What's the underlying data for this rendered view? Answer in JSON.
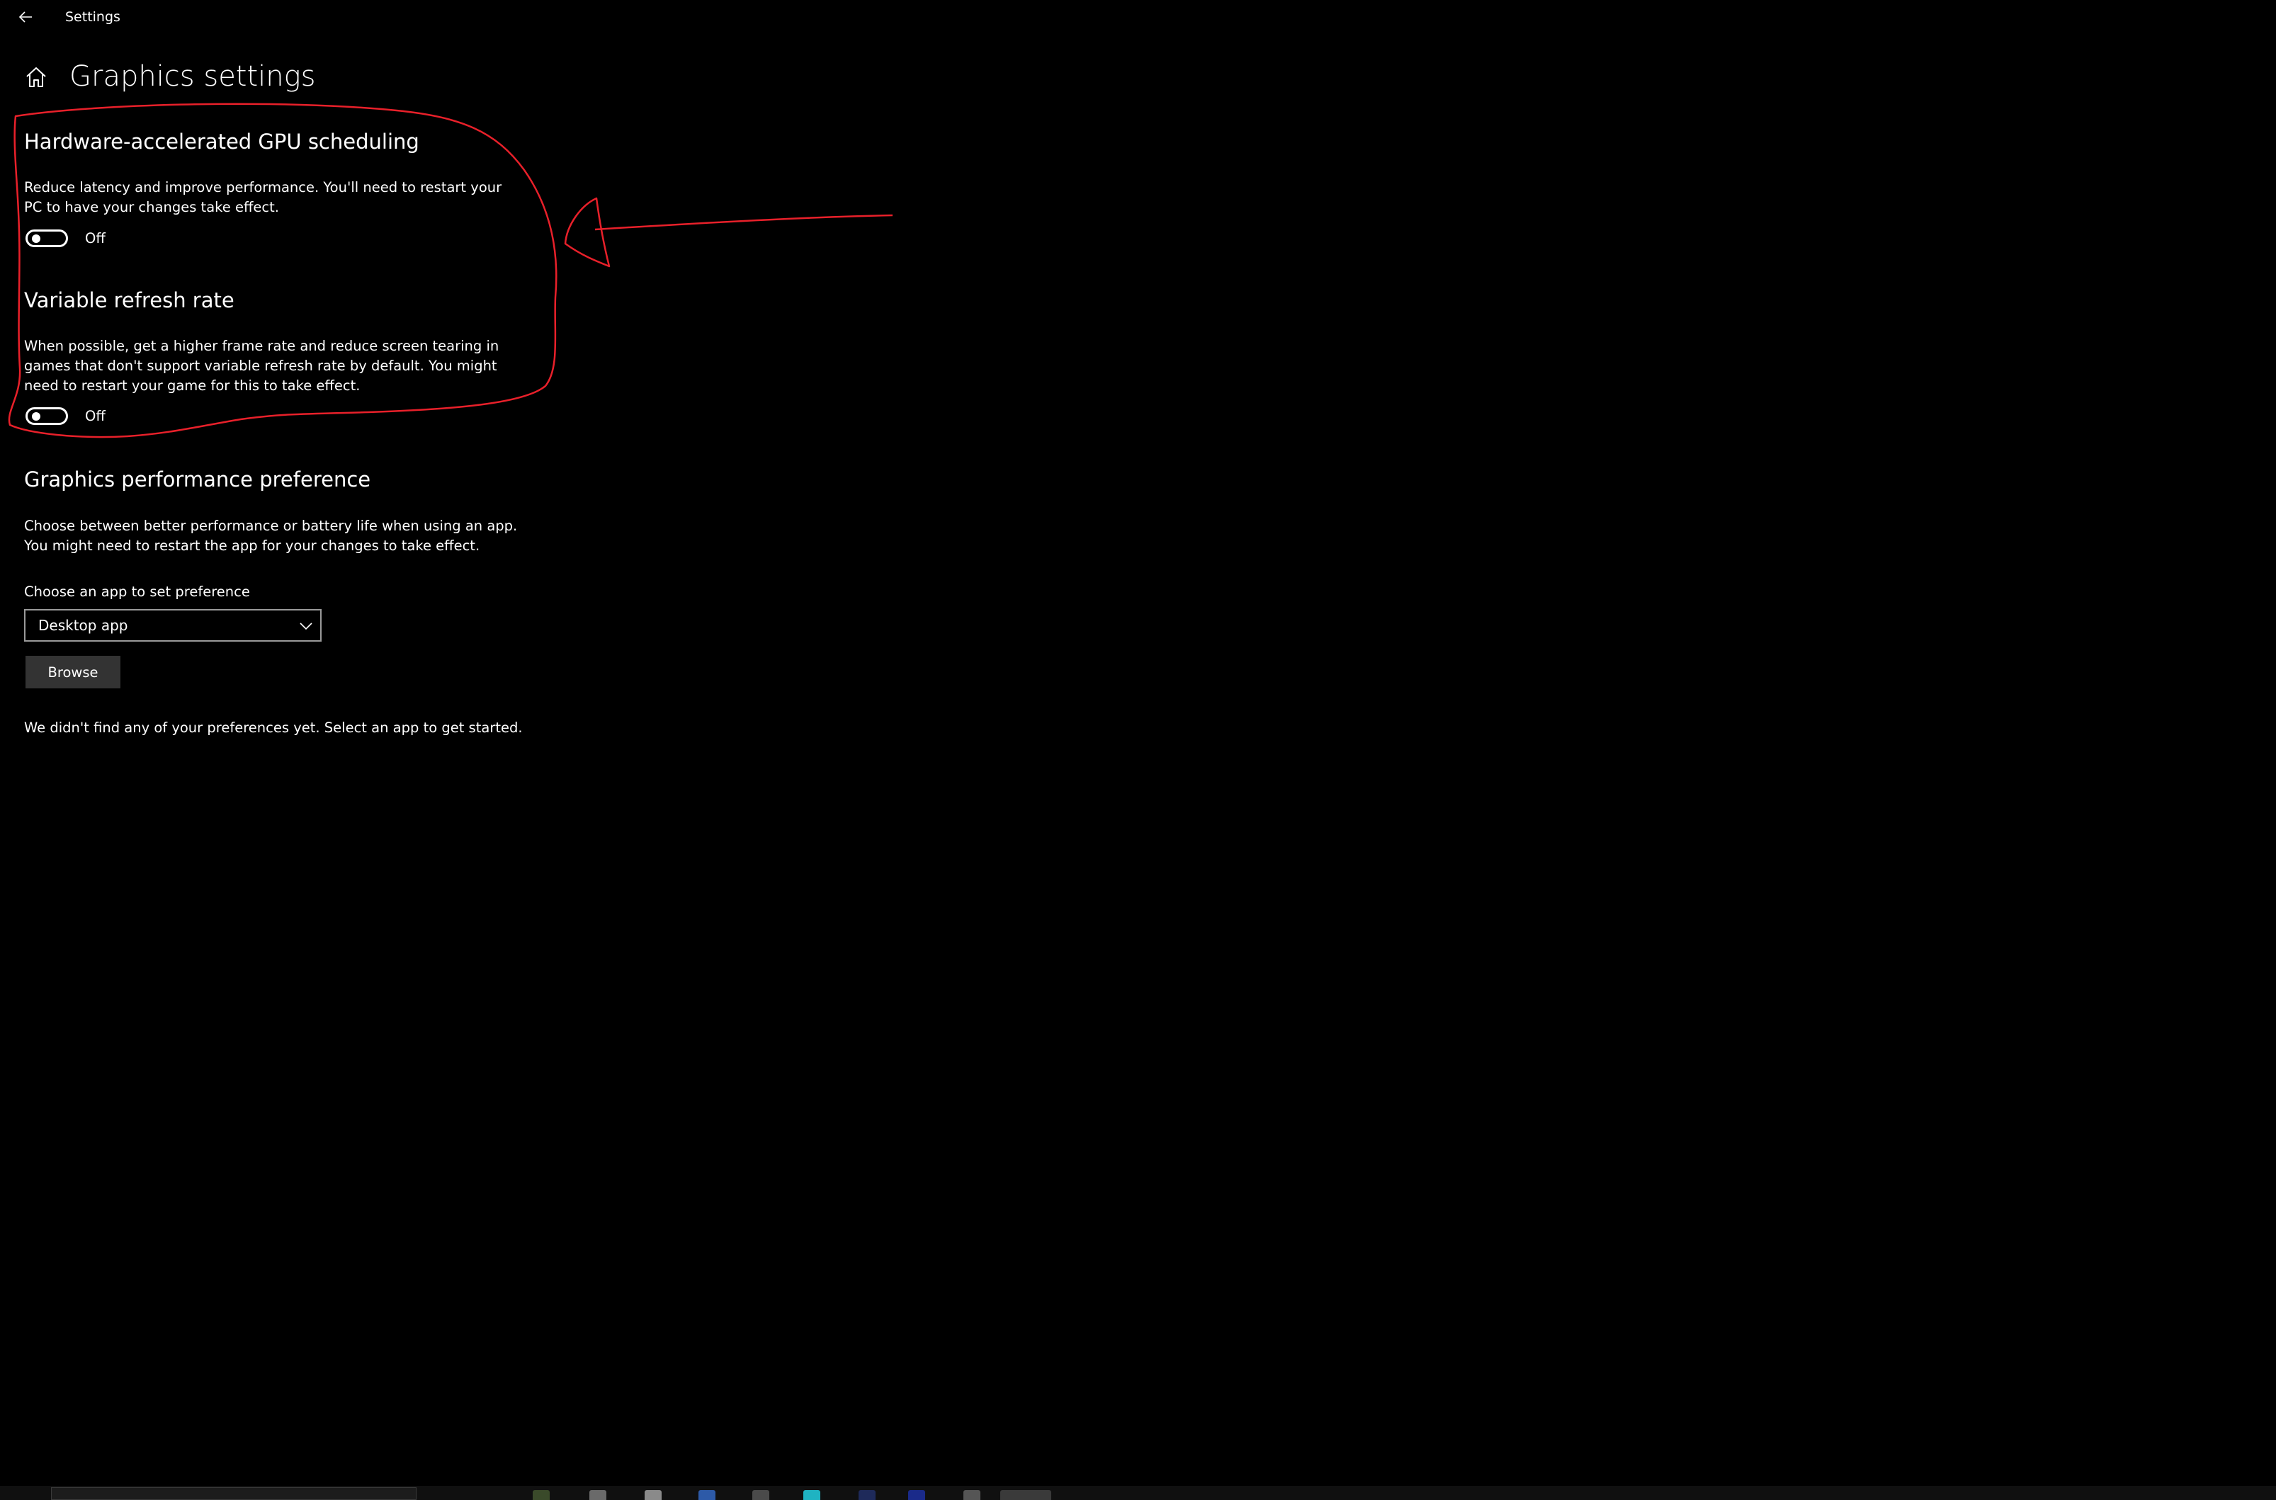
{
  "window": {
    "title": "Settings"
  },
  "page": {
    "title": "Graphics settings"
  },
  "gpu_scheduling": {
    "heading": "Hardware-accelerated GPU scheduling",
    "description_lines": [
      "Reduce latency and improve performance. You'll need to restart your",
      "PC to have your changes take effect."
    ],
    "toggle_state": "Off"
  },
  "variable_refresh": {
    "heading": "Variable refresh rate",
    "description_lines": [
      "When possible, get a higher frame rate and reduce screen tearing in",
      "games that don't support variable refresh rate by default. You might",
      "need to restart your game for this to take effect."
    ],
    "toggle_state": "Off"
  },
  "performance_preference": {
    "heading": "Graphics performance preference",
    "description_lines": [
      "Choose between better performance or battery life when using an app.",
      "You might need to restart the app for your changes to take effect."
    ],
    "choose_label": "Choose an app to set preference",
    "dropdown_value": "Desktop app",
    "browse_label": "Browse",
    "empty_message": "We didn't find any of your preferences yet. Select an app to get started."
  },
  "icons": {
    "back": "back-arrow-icon",
    "home": "home-icon",
    "dropdown": "chevron-down-icon"
  },
  "colors": {
    "background": "#000000",
    "text": "#ffffff",
    "annotation": "#e8202a",
    "button": "#333333"
  }
}
